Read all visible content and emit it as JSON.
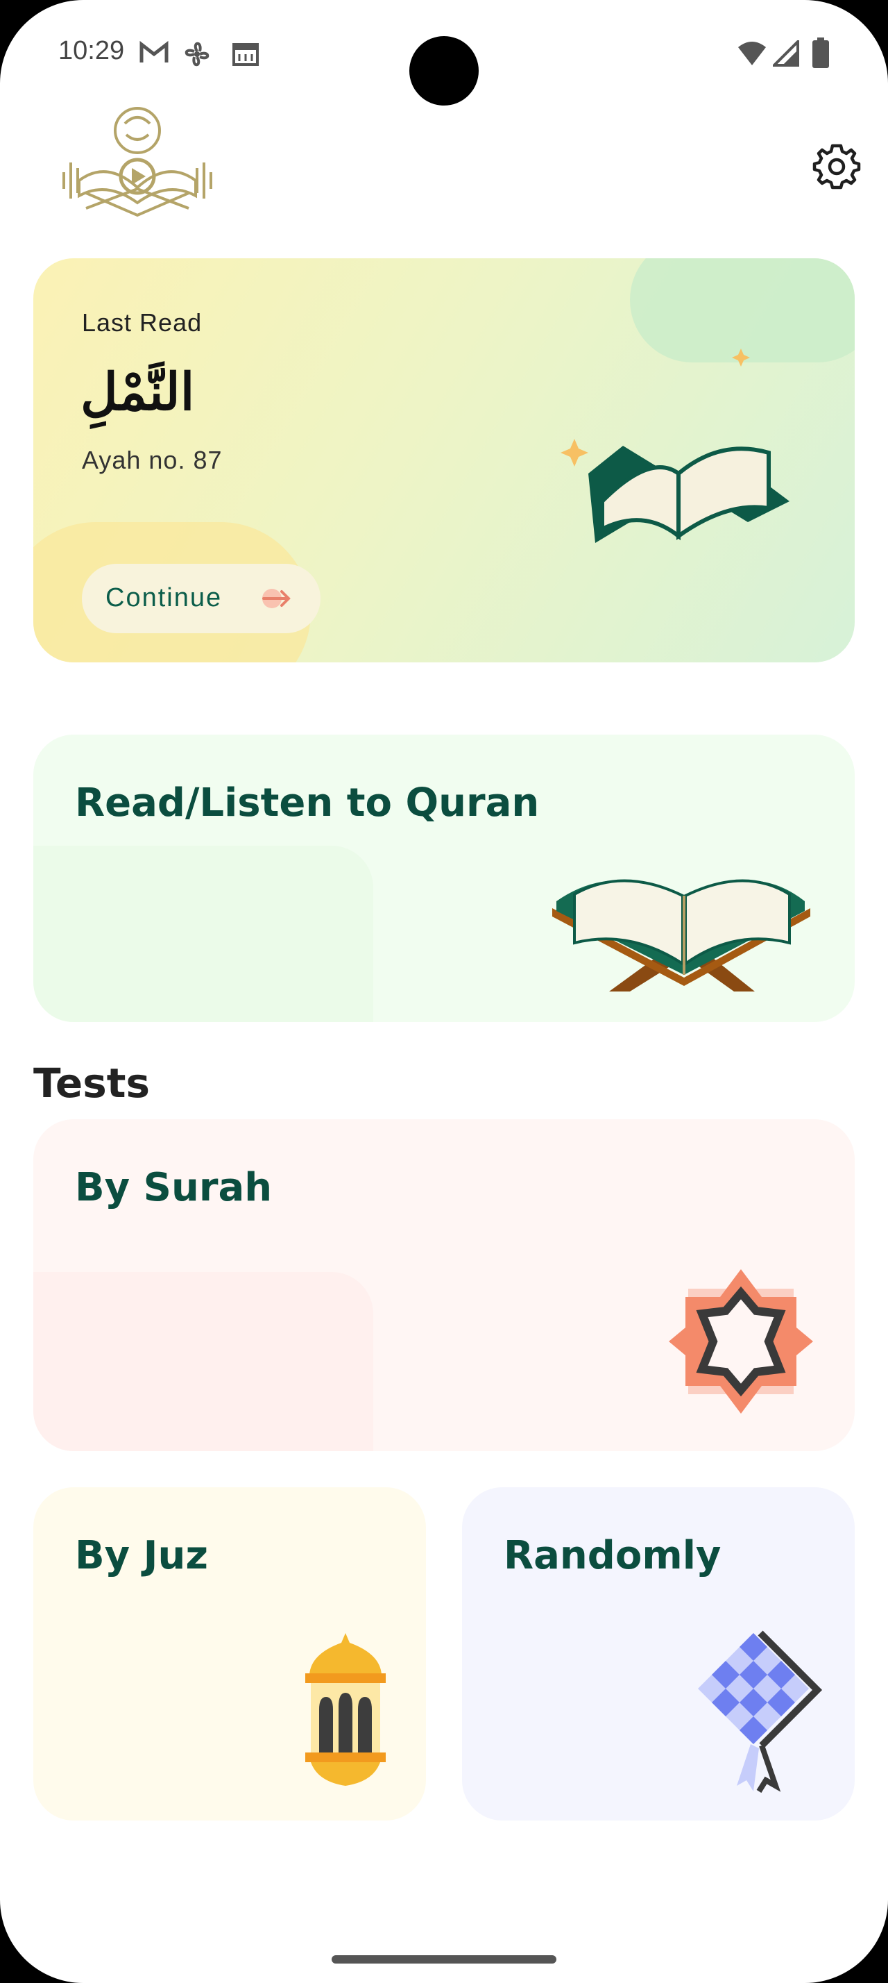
{
  "status_bar": {
    "time": "10:29",
    "icons_left": [
      "gmail-icon",
      "fan-icon",
      "calendar-icon"
    ],
    "icons_right": [
      "wifi-icon",
      "signal-icon",
      "battery-icon"
    ]
  },
  "header": {
    "logo_icon": "quran-audio-logo",
    "settings_icon": "gear-icon"
  },
  "last_read": {
    "label": "Last Read",
    "surah": "النَّمْلِ",
    "ayah": "Ayah no. 87",
    "continue_label": "Continue"
  },
  "read_card": {
    "title": "Read/Listen to Quran"
  },
  "tests": {
    "heading": "Tests",
    "by_surah": "By Surah",
    "by_juz": "By Juz",
    "randomly": "Randomly"
  },
  "colors": {
    "title_green": "#0b4d3f",
    "accent_orange": "#f48a6a",
    "accent_yellow": "#f5b82e",
    "accent_blue": "#6e7ff0"
  }
}
